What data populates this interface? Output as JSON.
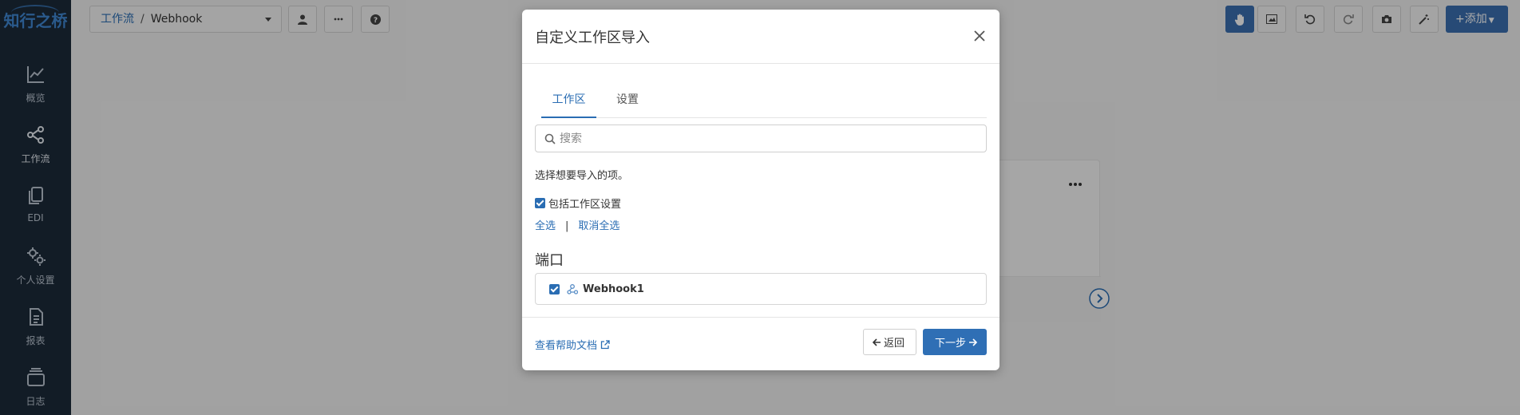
{
  "sidebar": {
    "logo": "知行之桥",
    "items": [
      {
        "label": "概览",
        "icon": "chart-line-icon"
      },
      {
        "label": "工作流",
        "icon": "workflow-icon"
      },
      {
        "label": "EDI",
        "icon": "copy-icon"
      },
      {
        "label": "个人设置",
        "icon": "gears-icon"
      },
      {
        "label": "报表",
        "icon": "report-icon"
      },
      {
        "label": "日志",
        "icon": "log-icon"
      }
    ]
  },
  "topbar": {
    "breadcrumb_root": "工作流",
    "breadcrumb_separator": "/",
    "breadcrumb_current": "Webhook",
    "add_label": "+添加"
  },
  "modal": {
    "title": "自定义工作区导入",
    "tabs": [
      {
        "label": "工作区",
        "active": true
      },
      {
        "label": "设置",
        "active": false
      }
    ],
    "search_placeholder": "搜索",
    "hint": "选择想要导入的项。",
    "include_settings_label": "包括工作区设置",
    "select_all": "全选",
    "divider": "|",
    "deselect_all": "取消全选",
    "section_title": "端口",
    "items": [
      {
        "name": "Webhook1",
        "checked": true
      }
    ],
    "help_link": "查看帮助文档",
    "back_label": "返回",
    "next_label": "下一步"
  },
  "colors": {
    "accent": "#2a6db3",
    "sidebar_bg": "#1c2a3a",
    "primary_button": "#2f6fb5"
  }
}
